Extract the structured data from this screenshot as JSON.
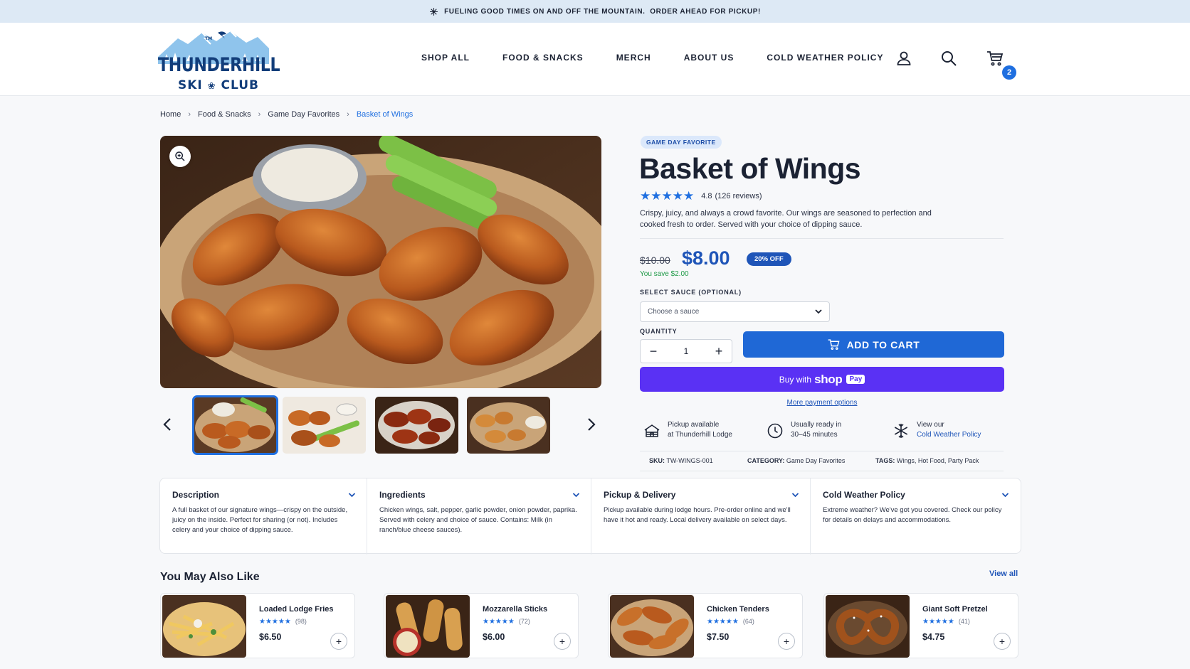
{
  "announcement": {
    "text": "FUELING GOOD TIMES ON AND OFF THE MOUNTAIN.  ORDER AHEAD FOR PICKUP!"
  },
  "logo": {
    "brand": "THUNDERHILL",
    "sub_left": "SKI",
    "sub_right": "CLUB",
    "tm": "TM"
  },
  "nav": {
    "items": [
      "SHOP ALL",
      "FOOD & SNACKS",
      "MERCH",
      "ABOUT US",
      "COLD WEATHER POLICY"
    ]
  },
  "cart": {
    "count": "2"
  },
  "breadcrumb": [
    "Home",
    "Food & Snacks",
    "Game Day Favorites",
    "Basket of Wings"
  ],
  "product": {
    "badge": "GAME DAY FAVORITE",
    "title": "Basket of Wings",
    "stars": "★★★★★",
    "rating": "4.8",
    "reviews": "(126 reviews)",
    "description": "Crispy, juicy, and always a crowd favorite. Our wings are seasoned to perfection and cooked fresh to order. Served with your choice of dipping sauce.",
    "old_price": "$10.00",
    "price": "$8.00",
    "discount": "20% OFF",
    "you_save": "You save $2.00",
    "sauce_label": "SELECT SAUCE (OPTIONAL)",
    "sauce_placeholder": "Choose a sauce",
    "quantity_label": "QUANTITY",
    "quantity": "1",
    "add_to_cart": "ADD TO CART",
    "buy_with": "Buy with",
    "shop": "shop",
    "pay": "Pay",
    "more_payment": "More payment options",
    "info": [
      {
        "line1": "Pickup available",
        "line2": "at Thunderhill Lodge"
      },
      {
        "line1": "Usually ready in",
        "line2": "30–45 minutes"
      },
      {
        "line1": "View our",
        "line2": "Cold Weather Policy"
      }
    ],
    "sku_label": "SKU:",
    "sku": "TW-WINGS-001",
    "category_label": "CATEGORY:",
    "category": "Game Day Favorites",
    "tags_label": "TAGS:",
    "tags": "Wings, Hot Food, Party Pack"
  },
  "accordion": [
    {
      "title": "Description",
      "body": "A full basket of our signature wings—crispy on the outside, juicy on the inside. Perfect for sharing (or not). Includes celery and your choice of dipping sauce."
    },
    {
      "title": "Ingredients",
      "body": "Chicken wings, salt, pepper, garlic powder, onion powder, paprika. Served with celery and choice of sauce. Contains: Milk (in ranch/blue cheese sauces)."
    },
    {
      "title": "Pickup & Delivery",
      "body": "Pickup available during lodge hours. Pre-order online and we'll have it hot and ready. Local delivery available on select days."
    },
    {
      "title": "Cold Weather Policy",
      "body": "Extreme weather? We've got you covered. Check our policy for details on delays and accommodations."
    }
  ],
  "recommendations": {
    "title": "You May Also Like",
    "view_all": "View all",
    "items": [
      {
        "name": "Loaded Lodge Fries",
        "stars": "★★★★★",
        "count": "(98)",
        "price": "$6.50"
      },
      {
        "name": "Mozzarella Sticks",
        "stars": "★★★★★",
        "count": "(72)",
        "price": "$6.00"
      },
      {
        "name": "Chicken Tenders",
        "stars": "★★★★★",
        "count": "(64)",
        "price": "$7.50"
      },
      {
        "name": "Giant Soft Pretzel",
        "stars": "★★★★★",
        "count": "(41)",
        "price": "$4.75"
      }
    ]
  },
  "colors": {
    "accent": "#1f6fe0",
    "brand_navy": "#123d7a",
    "shop_pay": "#5a31f4",
    "save_green": "#1f9a48"
  },
  "icons": [
    "snowflake-icon",
    "user-icon",
    "search-icon",
    "cart-icon",
    "zoom-icon",
    "chevron-left-icon",
    "chevron-right-icon",
    "chevron-down-icon",
    "lodge-icon",
    "clock-icon"
  ]
}
